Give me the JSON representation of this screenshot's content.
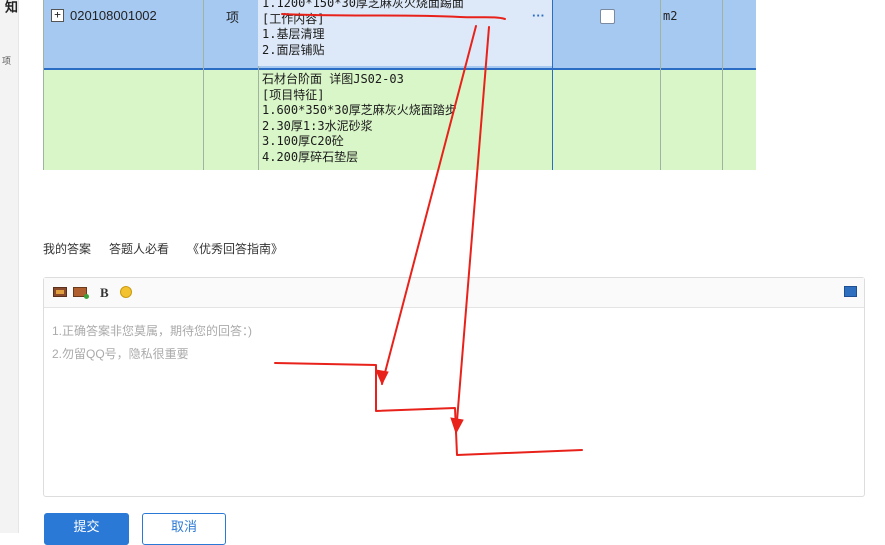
{
  "left_strip": {
    "char1": "知",
    "char2": "项"
  },
  "table": {
    "row1": {
      "code": "020108001002",
      "expand_icon": "plus-icon",
      "unit": "项",
      "desc_lines": [
        "1.1200*150*30厚芝麻灰火烧面踢面",
        "[工作内容]",
        "1.基层清理",
        "2.面层铺贴"
      ],
      "more": "···",
      "measure_unit": "m2"
    },
    "row2": {
      "desc_lines": [
        "石材台阶面 详图JS02-03",
        "[项目特征]",
        "1.600*350*30厚芝麻灰火烧面踏步",
        "2.30厚1:3水泥砂浆",
        "3.100厚C20砼",
        "4.200厚碎石垫层"
      ]
    }
  },
  "answer": {
    "tab_my_answer": "我的答案",
    "tab_must_read": "答题人必看",
    "guide_link": "《优秀回答指南》",
    "placeholder_line1": "1.正确答案非您莫属，期待您的回答：)",
    "placeholder_line2": "2.勿留QQ号，隐私很重要",
    "bold_label": "B",
    "submit_label": "提交",
    "cancel_label": "取消"
  },
  "colors": {
    "annotation": "#e8221b",
    "accent": "#2b79d6",
    "row_selected": "#a6c9f2",
    "row_green": "#d9f6c8"
  }
}
